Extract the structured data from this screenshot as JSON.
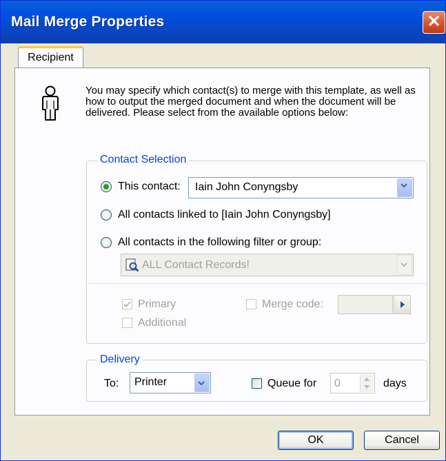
{
  "window": {
    "title": "Mail Merge Properties",
    "close_glyph": "✕"
  },
  "tabs": [
    {
      "label": "Recipient"
    }
  ],
  "intro_text": "You may specify which contact(s) to merge with this template, as well as how to output the merged document and when the document will be delivered.  Please select from the available options below:",
  "contact_selection": {
    "title": "Contact Selection",
    "this_contact_label": "This contact:",
    "this_contact_value": "Iain John Conyngsby",
    "linked_label": "All contacts linked to [Iain John Conyngsby]",
    "filter_label": "All contacts in the following filter or group:",
    "filter_value": "ALL Contact Records!",
    "selected_option": "this_contact",
    "primary_label": "Primary",
    "primary_checked": true,
    "additional_label": "Additional",
    "merge_code_label": "Merge code:",
    "merge_code_value": ""
  },
  "delivery": {
    "title": "Delivery",
    "to_label": "To:",
    "to_value": "Printer",
    "queue_label": "Queue for",
    "queue_value": "0",
    "days_label": "days"
  },
  "buttons": {
    "ok": "OK",
    "cancel": "Cancel"
  },
  "icons": {
    "person": "person-icon",
    "dropdown": "chevron-down-icon",
    "filter": "magnifier-icon",
    "arrow": "arrow-right-icon",
    "close": "close-icon"
  },
  "colors": {
    "title_bar": "#0050e0",
    "group_title": "#0046d5",
    "radio_dot": "#21a121",
    "close_button": "#d9532f"
  }
}
